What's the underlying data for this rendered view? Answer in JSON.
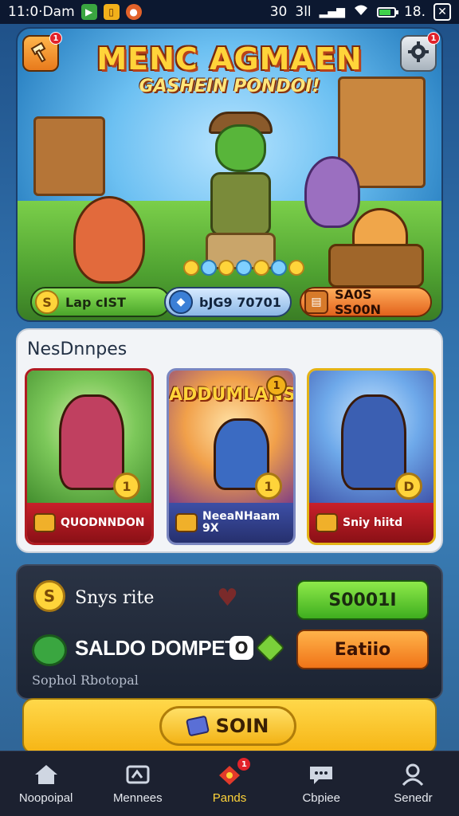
{
  "status_bar": {
    "time": "11:0·Dam",
    "signal_text": "30",
    "network_text": "3ll",
    "battery_text": "18."
  },
  "banner": {
    "title": "MENC AGMAEN",
    "subtitle": "GASHEIN PONDOI!",
    "corner_left_badge": "1",
    "corner_right_badge": "1",
    "stats": [
      {
        "label": "Lap cIST",
        "icon": "coin-icon"
      },
      {
        "label": "bJG9 70701",
        "icon": "gem-icon"
      },
      {
        "label": "SA0S SS00N",
        "icon": "box-icon"
      }
    ]
  },
  "new_section": {
    "title": "NesDnnpes",
    "cards": [
      {
        "headline": "",
        "coin": "1",
        "badge": "",
        "footer": "QUODNNDON"
      },
      {
        "headline": "ADDUMLANS",
        "coin": "1",
        "badge": "1",
        "footer": "NeeaNHaam 9X"
      },
      {
        "headline": "",
        "coin": "D",
        "badge": "",
        "footer": "Sniy hiitd"
      }
    ]
  },
  "wallet": {
    "label1": "Snys rite",
    "coin_symbol": "S",
    "label2": "SALDO DOMPET",
    "eye_symbol": "O",
    "sub": "Sophol Rbotopal",
    "btn_green": "S0001I",
    "btn_orange": "Eatiio"
  },
  "big_button": {
    "label": "SOIN"
  },
  "nav": {
    "items": [
      {
        "label": "Noopoipal",
        "icon": "home-icon"
      },
      {
        "label": "Mennees",
        "icon": "card-icon"
      },
      {
        "label": "Pands",
        "icon": "gift-icon",
        "badge": "1"
      },
      {
        "label": "Cbpiee",
        "icon": "chat-icon"
      },
      {
        "label": "Senedr",
        "icon": "profile-icon"
      }
    ]
  },
  "colors": {
    "accent_gold": "#ffd43a",
    "green_button": "#3fae1f",
    "orange_button": "#f07418",
    "nav_bg": "#1c2130"
  }
}
